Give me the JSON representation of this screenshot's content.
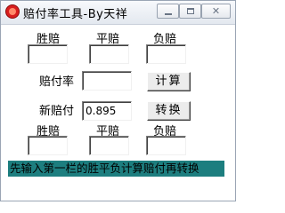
{
  "window": {
    "title": "赔付率工具-By天祥",
    "close_glyph": "✕"
  },
  "top_row": {
    "labels": [
      "胜赔",
      "平赔",
      "负赔"
    ],
    "values": [
      "",
      "",
      ""
    ]
  },
  "rate": {
    "label": "赔付率",
    "value": "",
    "button": "计算"
  },
  "new_rate": {
    "label": "新赔付",
    "value": "0.895",
    "button": "转换"
  },
  "bottom_row": {
    "labels": [
      "胜赔",
      "平赔",
      "负赔"
    ],
    "values": [
      "",
      "",
      ""
    ]
  },
  "status": {
    "text": "先输入第一栏的胜平负计算赔付再转换",
    "background": "#1d7e7f"
  },
  "colors": {
    "app_icon": "#d81e1e"
  }
}
